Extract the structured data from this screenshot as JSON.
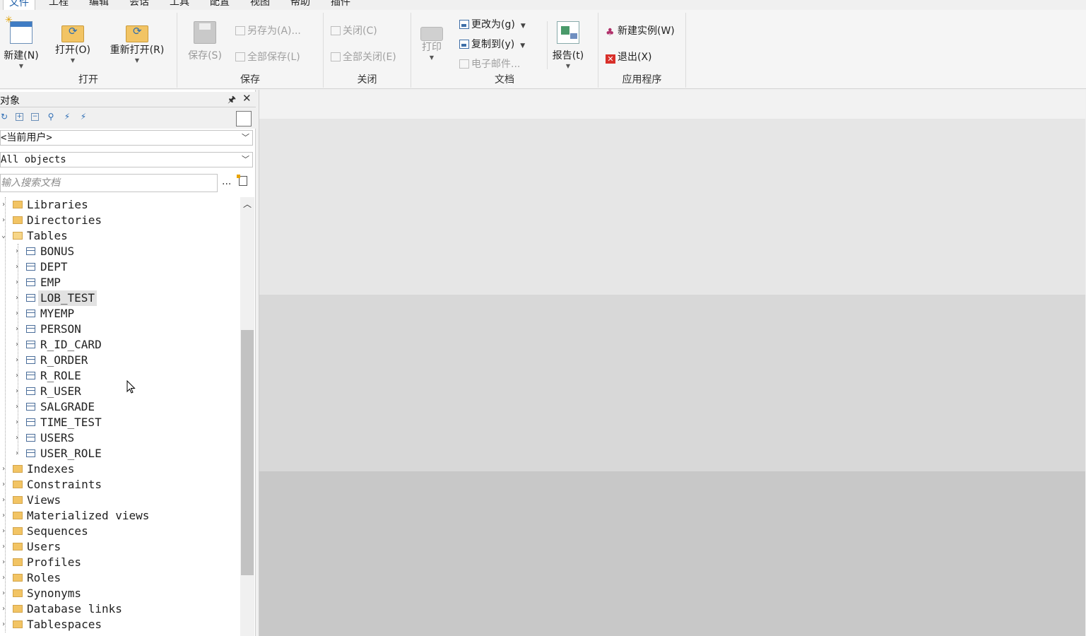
{
  "menu": {
    "tabs": [
      "文件",
      "工程",
      "编辑",
      "会话",
      "工具",
      "配置",
      "视图",
      "帮助",
      "插件"
    ],
    "active": "文件"
  },
  "ribbon": {
    "open_group": {
      "label": "打开",
      "new": "新建(N)",
      "open": "打开(O)",
      "reopen": "重新打开(R)"
    },
    "save_group": {
      "label": "保存",
      "save": "保存(S)",
      "save_as": "另存为(A)...",
      "save_all": "全部保存(L)"
    },
    "close_group": {
      "label": "关闭",
      "close": "关闭(C)",
      "close_all": "全部关闭(E)"
    },
    "document_group": {
      "label": "文档",
      "print": "打印",
      "change_to": "更改为(g)",
      "copy_to": "复制到(y)",
      "email": "电子邮件...",
      "report": "报告(t)"
    },
    "app_group": {
      "label": "应用程序",
      "new_instance": "新建实例(W)",
      "exit": "退出(X)"
    }
  },
  "object_panel": {
    "title": "对象",
    "user_combo": "<当前用户>",
    "filter_combo": "All objects",
    "search_placeholder": "输入搜索文档",
    "more": "..."
  },
  "tree": {
    "before": [
      "Libraries",
      "Directories"
    ],
    "tables_label": "Tables",
    "tables": [
      "BONUS",
      "DEPT",
      "EMP",
      "LOB_TEST",
      "MYEMP",
      "PERSON",
      "R_ID_CARD",
      "R_ORDER",
      "R_ROLE",
      "R_USER",
      "SALGRADE",
      "TIME_TEST",
      "USERS",
      "USER_ROLE"
    ],
    "selected": "LOB_TEST",
    "after": [
      "Indexes",
      "Constraints",
      "Views",
      "Materialized views",
      "Sequences",
      "Users",
      "Profiles",
      "Roles",
      "Synonyms",
      "Database links",
      "Tablespaces"
    ]
  },
  "icons": {
    "refresh": "refresh-icon",
    "expand_all": "expand-all-icon",
    "collapse_all": "collapse-all-icon",
    "find": "binoculars-icon",
    "filter_a": "filter-icon",
    "filter_b": "filter-edit-icon"
  }
}
